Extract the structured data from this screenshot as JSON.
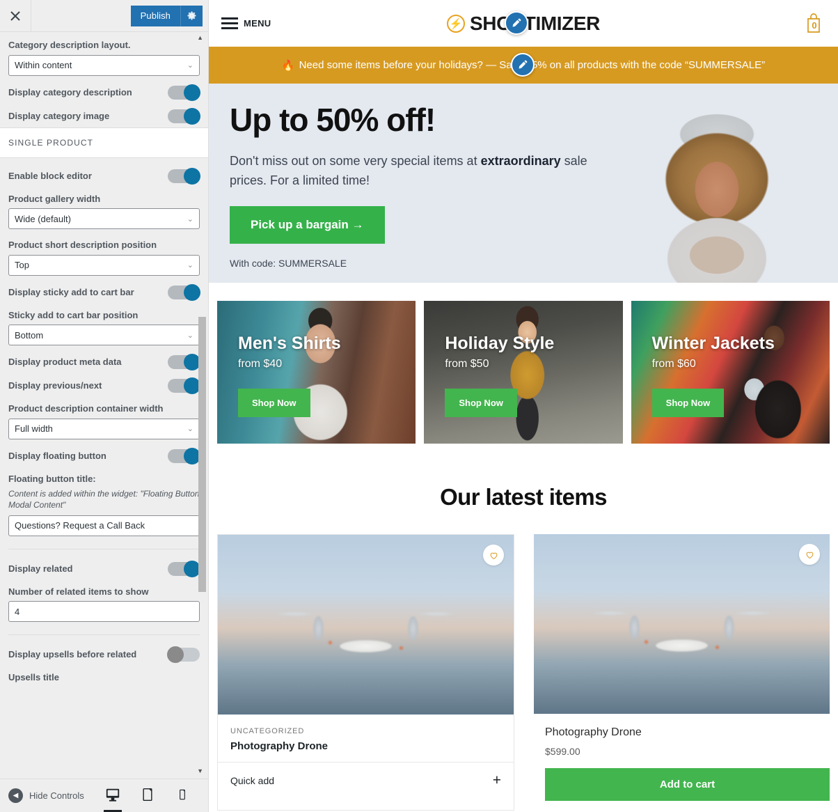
{
  "customizer": {
    "header": {
      "close_icon": "close-icon",
      "publish_label": "Publish",
      "gear_icon": "gear-icon"
    },
    "controls": [
      {
        "type": "select",
        "label": "Category description layout.",
        "value": "Within content"
      },
      {
        "type": "toggle",
        "label": "Display category description",
        "state": "on"
      },
      {
        "type": "toggle",
        "label": "Display category image",
        "state": "on"
      }
    ],
    "section_title": "SINGLE PRODUCT",
    "single_product_controls": [
      {
        "type": "toggle",
        "label": "Enable block editor",
        "state": "on"
      },
      {
        "type": "select",
        "label": "Product gallery width",
        "value": "Wide (default)"
      },
      {
        "type": "select",
        "label": "Product short description position",
        "value": "Top"
      },
      {
        "type": "toggle",
        "label": "Display sticky add to cart bar",
        "state": "on"
      },
      {
        "type": "select",
        "label": "Sticky add to cart bar position",
        "value": "Bottom"
      },
      {
        "type": "toggle",
        "label": "Display product meta data",
        "state": "on"
      },
      {
        "type": "toggle",
        "label": "Display previous/next",
        "state": "on"
      },
      {
        "type": "select",
        "label": "Product description container width",
        "value": "Full width"
      },
      {
        "type": "toggle",
        "label": "Display floating button",
        "state": "on"
      },
      {
        "type": "text",
        "label": "Floating button title:",
        "description": "Content is added within the widget: \"Floating Button Modal Content\"",
        "value": "Questions? Request a Call Back"
      },
      {
        "type": "toggle",
        "label": "Display related",
        "state": "on"
      },
      {
        "type": "text",
        "label": "Number of related items to show",
        "value": "4"
      },
      {
        "type": "toggle",
        "label": "Display upsells before related",
        "state": "off"
      },
      {
        "type": "label-only",
        "label": "Upsells title"
      }
    ],
    "footer": {
      "hide_controls_label": "Hide Controls",
      "devices": [
        {
          "name": "desktop",
          "icon": "desktop-icon",
          "active": true
        },
        {
          "name": "tablet",
          "icon": "tablet-icon",
          "active": false
        },
        {
          "name": "mobile",
          "icon": "mobile-icon",
          "active": false
        }
      ]
    }
  },
  "preview": {
    "header": {
      "menu_label": "MENU",
      "logo_text": "SHOPTIMIZER",
      "cart_count": "0"
    },
    "promo": {
      "flame": "🔥",
      "text": "Need some items before your holidays? — Save 25% on all products with the code “SUMMERSALE”"
    },
    "hero": {
      "title": "Up to 50% off!",
      "body_pre": "Don't miss out on some very special items at ",
      "body_bold": "extraordinary",
      "body_post": " sale prices. For a limited time!",
      "cta": "Pick up a bargain  →",
      "code_note": "With code: SUMMERSALE"
    },
    "categories": [
      {
        "title": "Men's Shirts",
        "price": "from $40",
        "button": "Shop Now",
        "art": "ph-men"
      },
      {
        "title": "Holiday Style",
        "price": "from $50",
        "button": "Shop Now",
        "art": "ph-holiday"
      },
      {
        "title": "Winter Jackets",
        "price": "from $60",
        "button": "Shop Now",
        "art": "ph-winter"
      }
    ],
    "latest": {
      "heading": "Our latest items",
      "products": [
        {
          "category": "UNCATEGORIZED",
          "name": "Photography Drone",
          "quick_add_label": "Quick add",
          "quick_add_icon": "plus-icon",
          "wishlist_icon": "heart-icon"
        },
        {
          "name": "Photography Drone",
          "price": "$599.00",
          "add_to_cart_label": "Add to cart",
          "wishlist_icon": "heart-icon"
        }
      ]
    }
  },
  "colors": {
    "publish_blue": "#2271b1",
    "toggle_on": "#0d74a4",
    "promo_gold": "#d79a21",
    "cta_green": "#35b14a",
    "shop_green": "#43b54e",
    "hero_bg": "#e4e9f0",
    "brand_orange": "#e8a322"
  }
}
